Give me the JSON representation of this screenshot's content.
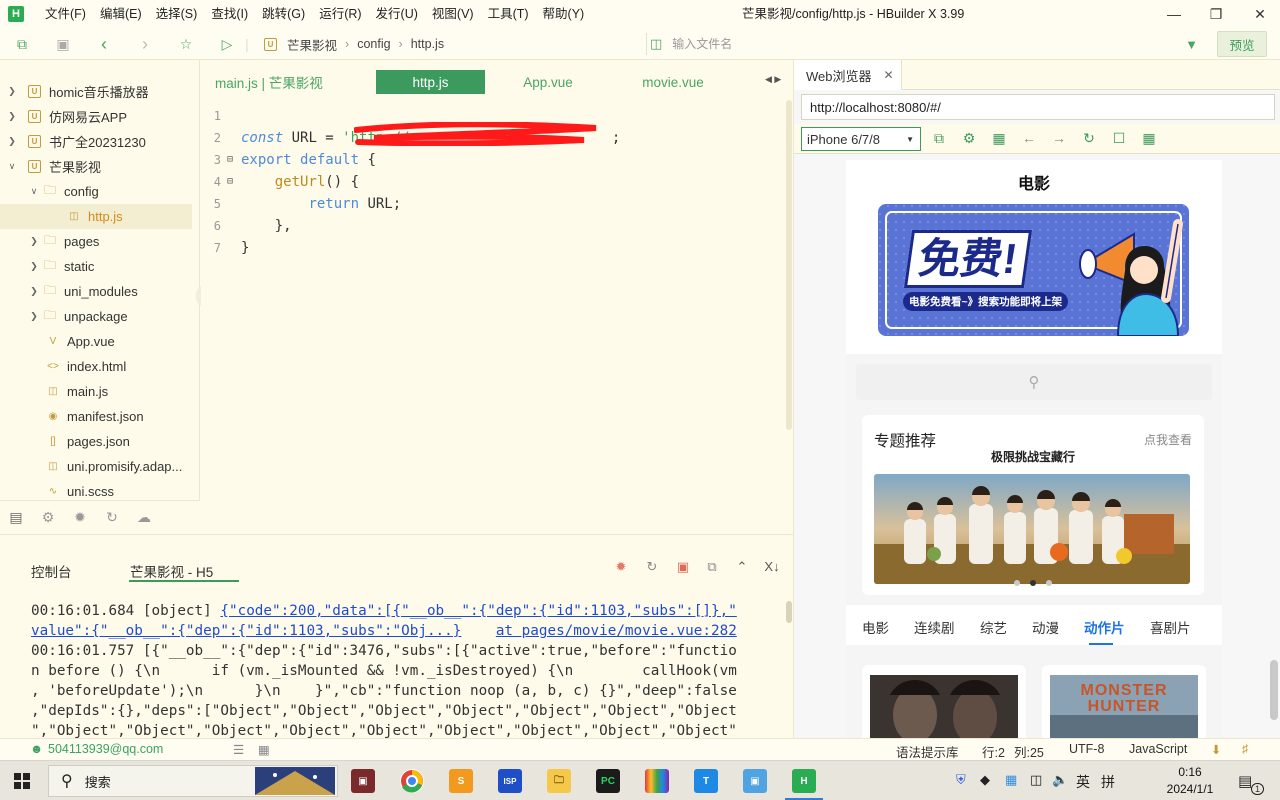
{
  "window": {
    "title": "芒果影视/config/http.js - HBuilder X 3.99",
    "logo_letter": "H"
  },
  "menu": [
    "文件(F)",
    "编辑(E)",
    "选择(S)",
    "查找(I)",
    "跳转(G)",
    "运行(R)",
    "发行(U)",
    "视图(V)",
    "工具(T)",
    "帮助(Y)"
  ],
  "toolbar": {
    "breadcrumb": [
      "芒果影视",
      "config",
      "http.js"
    ],
    "file_search_placeholder": "输入文件名",
    "preview_label": "预览"
  },
  "sidebar": {
    "items": [
      {
        "label": "homic音乐播放器",
        "kind": "project",
        "expanded": false
      },
      {
        "label": "仿网易云APP",
        "kind": "project",
        "expanded": false
      },
      {
        "label": "书广全20231230",
        "kind": "project",
        "expanded": false
      },
      {
        "label": "芒果影视",
        "kind": "project",
        "expanded": true
      },
      {
        "label": "config",
        "kind": "folder",
        "expanded": true
      },
      {
        "label": "http.js",
        "kind": "file",
        "selected": true
      },
      {
        "label": "pages",
        "kind": "folder",
        "expanded": false
      },
      {
        "label": "static",
        "kind": "folder",
        "expanded": false
      },
      {
        "label": "uni_modules",
        "kind": "folder",
        "expanded": false
      },
      {
        "label": "unpackage",
        "kind": "folder",
        "expanded": false
      },
      {
        "label": "App.vue",
        "kind": "file"
      },
      {
        "label": "index.html",
        "kind": "file"
      },
      {
        "label": "main.js",
        "kind": "file"
      },
      {
        "label": "manifest.json",
        "kind": "file"
      },
      {
        "label": "pages.json",
        "kind": "file"
      },
      {
        "label": "uni.promisify.adap...",
        "kind": "file"
      },
      {
        "label": "uni.scss",
        "kind": "file"
      }
    ]
  },
  "editor": {
    "tabs": [
      {
        "label": "main.js | 芒果影视",
        "active": false
      },
      {
        "label": "http.js",
        "active": true
      },
      {
        "label": "App.vue",
        "active": false
      },
      {
        "label": "movie.vue",
        "active": false
      }
    ],
    "line_numbers": [
      "1",
      "2",
      "3",
      "4",
      "5",
      "6",
      "7"
    ]
  },
  "console": {
    "tabs": [
      "控制台",
      "芒果影视 - H5"
    ],
    "lines": [
      "00:16:01.684 [object] ",
      "{\"code\":200,\"data\":[{\"__ob__\":{\"dep\":{\"id\":1103,\"subs\":[]},\"",
      "value\":{\"__ob__\":{\"dep\":{\"id\":1103,\"subs\":\"Obj...}",
      "at pages/movie/movie.vue:282",
      "00:16:01.757 [{\"__ob__\":{\"dep\":{\"id\":3476,\"subs\":[{\"active\":true,\"before\":\"functio",
      "n before () {\\n      if (vm._isMounted && !vm._isDestroyed) {\\n        callHook(vm",
      ", 'beforeUpdate');\\n      }\\n    }\",\"cb\":\"function noop (a, b, c) {}\",\"deep\":false",
      ",\"depIds\":{},\"deps\":[\"Object\",\"Object\",\"Object\",\"Object\",\"Object\",\"Object\",\"Object",
      "\",\"Object\",\"Object\",\"Object\",\"Object\",\"Object\",\"Object\",\"Object\",\"Object\",\"Object\""
    ]
  },
  "status": {
    "user": "504113939@qq.com",
    "grammar": "语法提示库",
    "row": "行:2",
    "col": "列:25",
    "encoding": "UTF-8",
    "language": "JavaScript"
  },
  "browser": {
    "tab_label": "Web浏览器",
    "url": "http://localhost:8080/#/",
    "device": "iPhone 6/7/8"
  },
  "phone": {
    "header": "电影",
    "banner_title": "免费!",
    "banner_sub": "电影免费看~》搜索功能即将上架",
    "topic_title": "专题推荐",
    "topic_more": "点我查看",
    "topic_subtitle": "极限挑战宝藏行",
    "categories": [
      "电影",
      "连续剧",
      "综艺",
      "动漫",
      "动作片",
      "喜剧片"
    ],
    "active_category": "动作片",
    "poster2_title": "MONSTER HUNTER"
  },
  "taskbar": {
    "search_label": "搜索",
    "time": "0:16",
    "date": "2024/1/1",
    "ime": "英",
    "ime2": "拼",
    "notification_count": "1"
  },
  "colors": {
    "accent": "#3d9a5e",
    "editor_bg": "#fffbea",
    "link": "#1f4bd1",
    "active_category": "#1a73e8"
  }
}
